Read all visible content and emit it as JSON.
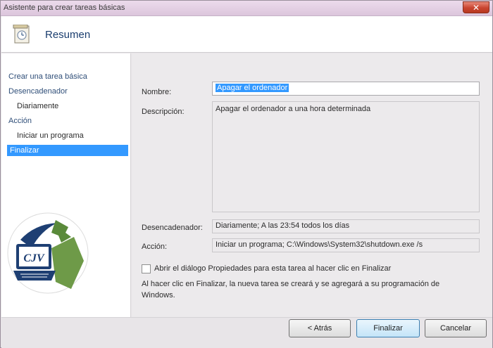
{
  "window": {
    "title": "Asistente para crear tareas básicas",
    "close_glyph": "✕"
  },
  "header": {
    "title": "Resumen",
    "icon": "task-wizard-icon"
  },
  "sidebar": {
    "items": [
      {
        "label": "Crear una tarea básica",
        "level": 0
      },
      {
        "label": "Desencadenador",
        "level": 0
      },
      {
        "label": "Diariamente",
        "level": 1
      },
      {
        "label": "Acción",
        "level": 0
      },
      {
        "label": "Iniciar un programa",
        "level": 1
      },
      {
        "label": "Finalizar",
        "level": 0,
        "selected": true
      }
    ]
  },
  "form": {
    "name_label": "Nombre:",
    "name_value": "Apagar el ordenador",
    "description_label": "Descripción:",
    "description_value": "Apagar el ordenador a una hora determinada",
    "trigger_label": "Desencadenador:",
    "trigger_value": "Diariamente; A las 23:54 todos los días",
    "action_label": "Acción:",
    "action_value": "Iniciar un programa; C:\\Windows\\System32\\shutdown.exe /s",
    "checkbox_label": "Abrir el diálogo Propiedades para esta tarea al hacer clic en Finalizar",
    "checkbox_checked": false,
    "info_text": "Al hacer clic en Finalizar, la nueva tarea se creará y se agregará a su programación de Windows."
  },
  "buttons": {
    "back": "< Atrás",
    "finish": "Finalizar",
    "cancel": "Cancelar"
  },
  "logo": {
    "text": "CJV"
  }
}
